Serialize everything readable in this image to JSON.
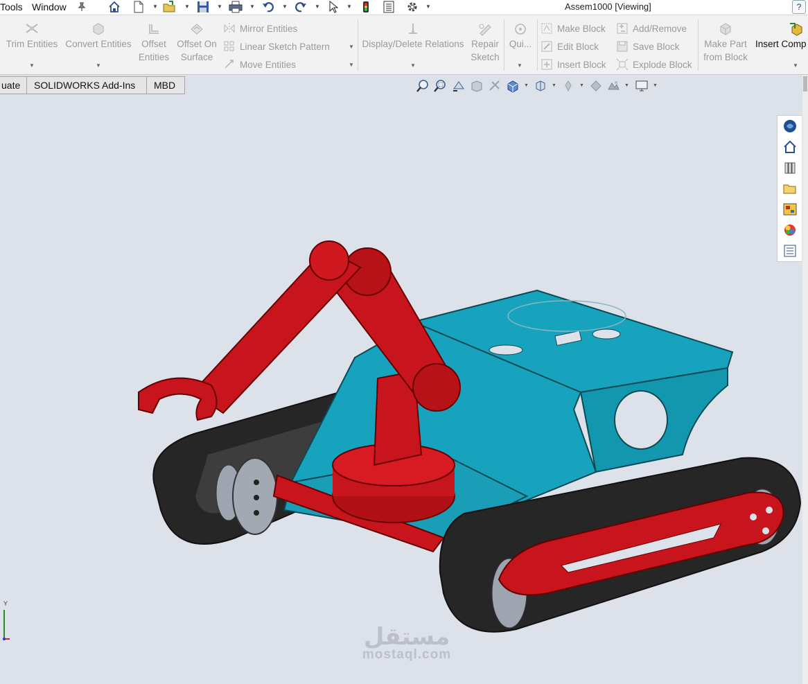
{
  "menubar": {
    "items": [
      "Tools",
      "Window"
    ],
    "title": "Assem1000 [Viewing]",
    "help": "?"
  },
  "ribbon": {
    "trim_entities": "Trim Entities",
    "convert_entities": "Convert Entities",
    "offset_entities": [
      "Offset",
      "Entities"
    ],
    "offset_on_surface": [
      "Offset On",
      "Surface"
    ],
    "mirror_entities": "Mirror Entities",
    "linear_sketch_pattern": "Linear Sketch Pattern",
    "move_entities": "Move Entities",
    "display_delete_relations": "Display/Delete Relations",
    "repair_sketch": [
      "Repair",
      "Sketch"
    ],
    "quick_snaps": "Qui...",
    "make_block": "Make Block",
    "edit_block": "Edit Block",
    "insert_block": "Insert Block",
    "add_remove": "Add/Remove",
    "save_block": "Save Block",
    "explode_block": "Explode Block",
    "make_part_from_block": [
      "Make Part",
      "from Block"
    ],
    "insert_components": "Insert Comp"
  },
  "tabs": [
    "uate",
    "SOLIDWORKS Add-Ins",
    "MBD"
  ],
  "viewport": {
    "axis_label": "Y"
  },
  "watermark": {
    "arabic": "مستقل",
    "latin": "mostaql.com"
  },
  "colors": {
    "arm_red": "#c8141c",
    "chassis_teal": "#1aa3bb",
    "track_black": "#262626",
    "background": "#dde1ea"
  },
  "icons": [
    "home-icon",
    "new-document-icon",
    "open-icon",
    "save-icon",
    "print-icon",
    "undo-icon",
    "redo-icon",
    "select-icon",
    "rebuild-icon",
    "file-properties-icon",
    "options-icon",
    "pin-icon"
  ]
}
